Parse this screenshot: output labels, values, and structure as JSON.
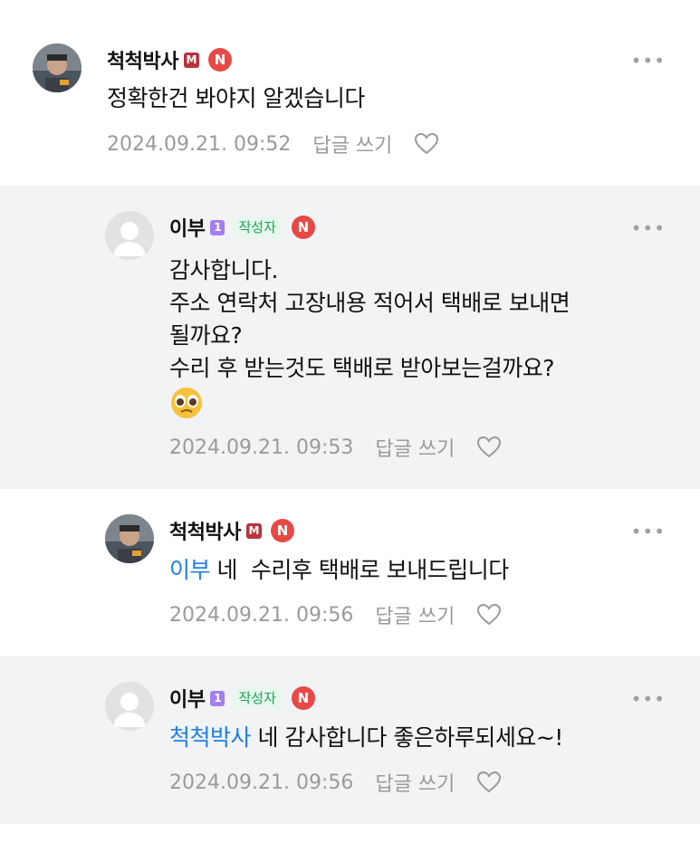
{
  "comments": [
    {
      "author": "척척박사",
      "level_badge": "M",
      "naver_badge": "N",
      "mention": "",
      "text": "정확한건 봐야지 알겠습니다",
      "date": "2024.09.21. 09:52",
      "reply_label": "답글 쓰기"
    },
    {
      "author": "이부",
      "level_badge": "1",
      "author_tag": "작성자",
      "naver_badge": "N",
      "lines": [
        "감사합니다.",
        "주소 연락처 고장내용 적어서 택배로 보내면",
        "될까요?",
        "수리 후 받는것도 택배로 받아보는걸까요?"
      ],
      "emoji": "🥹",
      "date": "2024.09.21. 09:53",
      "reply_label": "답글 쓰기"
    },
    {
      "author": "척척박사",
      "level_badge": "M",
      "naver_badge": "N",
      "mention": "이부",
      "text": " 네  수리후 택배로 보내드립니다",
      "date": "2024.09.21. 09:56",
      "reply_label": "답글 쓰기"
    },
    {
      "author": "이부",
      "level_badge": "1",
      "author_tag": "작성자",
      "naver_badge": "N",
      "mention": "척척박사",
      "text": " 네 감사합니다 좋은하루되세요~!",
      "date": "2024.09.21. 09:56",
      "reply_label": "답글 쓰기"
    }
  ],
  "more_label": "•••"
}
